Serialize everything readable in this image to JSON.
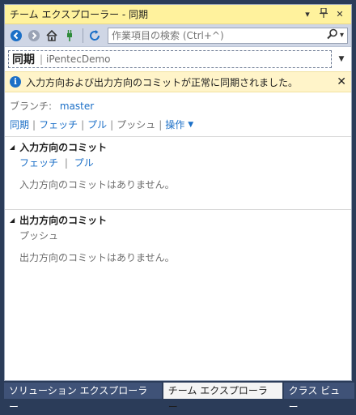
{
  "window": {
    "title": "チーム エクスプローラー - 同期",
    "pin_glyph": "▾",
    "dock_glyph": "ꟼ",
    "close_glyph": "×"
  },
  "toolbar": {
    "search_placeholder": "作業項目の検索 (Ctrl+^)"
  },
  "nav": {
    "page": "同期",
    "separator": "|",
    "repo": "iPentecDemo"
  },
  "info": {
    "icon_glyph": "i",
    "message": "入力方向および出力方向のコミットが正常に同期されました。",
    "close_glyph": "✕"
  },
  "branch": {
    "label": "ブランチ:",
    "value": "master"
  },
  "actions": {
    "sync": "同期",
    "fetch": "フェッチ",
    "pull": "プル",
    "push": "プッシュ",
    "ops": "操作",
    "pipe": "|"
  },
  "incoming": {
    "title": "入力方向のコミット",
    "fetch": "フェッチ",
    "pull": "プル",
    "pipe": "|",
    "empty": "入力方向のコミットはありません。"
  },
  "outgoing": {
    "title": "出力方向のコミット",
    "push": "プッシュ",
    "empty": "出力方向のコミットはありません。"
  },
  "tabs": [
    {
      "label": "ソリューション エクスプローラー"
    },
    {
      "label": "チーム エクスプローラー"
    },
    {
      "label": "クラス ビュー"
    }
  ]
}
